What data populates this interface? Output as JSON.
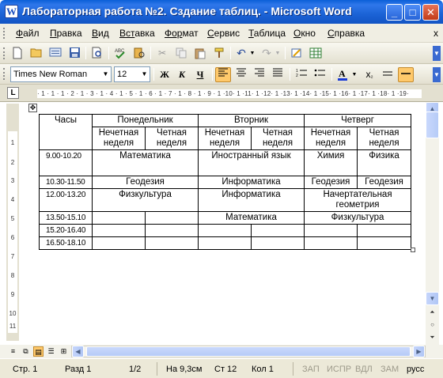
{
  "window": {
    "title": "Лабораторная работа №2. Сздание таблиц. - Microsoft Word",
    "app_icon": "W",
    "minimize": "_",
    "maximize": "□",
    "close": "✕"
  },
  "menu": {
    "items": [
      {
        "first": "Ф",
        "rest": "айл"
      },
      {
        "first": "П",
        "rest": "равка"
      },
      {
        "first": "В",
        "rest": "ид"
      },
      {
        "first": "Вст",
        "rest": "авка"
      },
      {
        "first": "Фор",
        "rest": "мат"
      },
      {
        "first": "С",
        "rest": "ервис"
      },
      {
        "first": "Т",
        "rest": "аблица"
      },
      {
        "first": "О",
        "rest": "кно"
      },
      {
        "first": "С",
        "rest": "правка"
      }
    ],
    "doc_close": "x"
  },
  "formatting": {
    "font": "Times New Roman",
    "size": "12",
    "bold": "Ж",
    "italic": "К",
    "underline": "Ч"
  },
  "ruler": {
    "scale": "· 1 · 1 · 1 · 2 · 1 · 3 · 1 · 4 · 1 · 5 · 1 · 6 · 1 · 7 · 1 · 8 · 1 · 9 · 1 ·10· 1 ·11· 1 ·12· 1 ·13· 1 ·14· 1 ·15· 1 ·16· 1 ·17· 1 ·18· 1 ·19·",
    "vertical": [
      "1",
      "2",
      "3",
      "4",
      "5",
      "6",
      "7",
      "8",
      "9",
      "10",
      "11"
    ]
  },
  "table": {
    "header": {
      "hours": "Часы",
      "days": [
        "Понедельник",
        "Вторник",
        "Четверг"
      ],
      "odd": "Нечетная неделя",
      "even": "Четная неделя"
    },
    "rows": [
      {
        "time": "9.00-10.20",
        "mon": "Математика",
        "tue": "Иностранный язык",
        "thu_odd": "Химия",
        "thu_even": "Физика"
      },
      {
        "time": "10.30-11.50",
        "mon": "Геодезия",
        "tue": "Информатика",
        "thu_odd": "Геодезия",
        "thu_even": "Геодезия"
      },
      {
        "time": "12.00-13.20",
        "mon": "Физкультура",
        "tue": "Информатика",
        "thu": "Начертательная геометрия"
      },
      {
        "time": "13.50-15.10",
        "tue": "Математика",
        "thu": "Физкультура"
      },
      {
        "time": "15.20-16.40"
      },
      {
        "time": "16.50-18.10"
      }
    ]
  },
  "status": {
    "page": "Стр. 1",
    "section": "Разд 1",
    "pages": "1/2",
    "at": "На 9,3см",
    "line": "Ст 12",
    "col": "Кол 1",
    "rec": "ЗАП",
    "trk": "ИСПР",
    "ext": "ВДЛ",
    "ovr": "ЗАМ",
    "lang": "русс"
  }
}
